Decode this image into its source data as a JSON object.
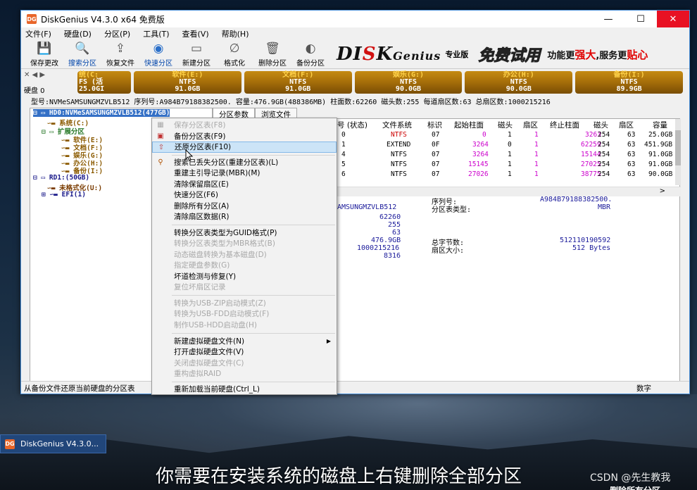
{
  "window": {
    "title": "DiskGenius V4.3.0 x64 免费版",
    "controls": {
      "minimize": "—",
      "maximize": "☐",
      "close": "✕"
    }
  },
  "menubar": [
    "文件(F)",
    "硬盘(D)",
    "分区(P)",
    "工具(T)",
    "查看(V)",
    "帮助(H)"
  ],
  "toolbar": [
    {
      "label": "保存更改",
      "icon": "save-icon"
    },
    {
      "label": "搜索分区",
      "icon": "search-icon"
    },
    {
      "label": "恢复文件",
      "icon": "recover-icon"
    },
    {
      "label": "快速分区",
      "icon": "quick-partition-icon"
    },
    {
      "label": "新建分区",
      "icon": "new-partition-icon"
    },
    {
      "label": "格式化",
      "icon": "format-icon"
    },
    {
      "label": "删除分区",
      "icon": "delete-icon"
    },
    {
      "label": "备份分区",
      "icon": "backup-icon"
    }
  ],
  "banner": {
    "logo_a": "DI",
    "logo_b": "K",
    "logo_c": "Genius",
    "edition": "专业版",
    "free": "免费试用",
    "slogan_a": "功能更",
    "slogan_b": "强大",
    "slogan_c": ",服务更",
    "slogan_d": "贴心"
  },
  "disk_nav": {
    "label": "硬盘 0"
  },
  "partitions": [
    {
      "name": "统(C:",
      "fs": "FS (活",
      "size": "25.0GI"
    },
    {
      "name": "软件(E:)",
      "fs": "NTFS",
      "size": "91.0GB"
    },
    {
      "name": "文档(F:)",
      "fs": "NTFS",
      "size": "91.0GB"
    },
    {
      "name": "娱乐(G:)",
      "fs": "NTFS",
      "size": "90.0GB"
    },
    {
      "name": "办公(H:)",
      "fs": "NTFS",
      "size": "90.0GB"
    },
    {
      "name": "备份(I:)",
      "fs": "NTFS",
      "size": "89.9GB"
    }
  ],
  "diskinfo": "型号:NVMeSAMSUNGMZVLB512  序列号:A984B79188382500.   容量:476.9GB(488386MB)  柱面数:62260  磁头数:255  每道扇区数:63  总扇区数:1000215216",
  "tree": {
    "hd0": "HD0:NVMeSAMSUNGMZVLB512(477GB)",
    "c": "系统(C:)",
    "ext": "扩展分区",
    "e": "软件(E:)",
    "f": "文档(F:)",
    "g": "娱乐(G:)",
    "h": "办公(H:)",
    "i": "备份(I:)",
    "rd1": "RD1:(50GB)",
    "unformatted": "未格式化(U:)",
    "efi": "EFI(1)"
  },
  "tabs": [
    "分区参数",
    "浏览文件"
  ],
  "table": {
    "headers": [
      "号 (状态)",
      "文件系统",
      "标识",
      "起始柱面",
      "磁头",
      "扇区",
      "终止柱面",
      "磁头",
      "扇区",
      "容量"
    ],
    "rows": [
      [
        "0",
        "NTFS",
        "07",
        "0",
        "1",
        "1",
        "3263",
        "254",
        "63",
        "25.0GB"
      ],
      [
        "1",
        "EXTEND",
        "0F",
        "3264",
        "0",
        "1",
        "62259",
        "254",
        "63",
        "451.9GB"
      ],
      [
        "4",
        "NTFS",
        "07",
        "3264",
        "1",
        "1",
        "15144",
        "254",
        "63",
        "91.0GB"
      ],
      [
        "5",
        "NTFS",
        "07",
        "15145",
        "1",
        "1",
        "27025",
        "254",
        "63",
        "91.0GB"
      ],
      [
        "6",
        "NTFS",
        "07",
        "27026",
        "1",
        "1",
        "38775",
        "254",
        "63",
        "90.0GB"
      ]
    ]
  },
  "details": {
    "model": "AMSUNGMZVLB512",
    "cyl": "62260",
    "heads": "255",
    "spt": "63",
    "cap": "476.9GB",
    "sectors": "1000215216",
    "extra": "8316",
    "serial_label": "序列号:",
    "serial_value": "A984B79188382500.",
    "ptype_label": "分区表类型:",
    "ptype_value": "MBR",
    "bytes_label": "总字节数:",
    "bytes_value": "512110190592",
    "secsize_label": "扇区大小:",
    "secsize_value": "512 Bytes"
  },
  "status": {
    "text": "从备份文件还原当前硬盘的分区表",
    "num": "数字"
  },
  "context_menu": [
    {
      "label": "保存分区表(F8)",
      "disabled": true,
      "icon": "save-icon"
    },
    {
      "label": "备份分区表(F9)",
      "disabled": false,
      "icon": "backup-table-icon"
    },
    {
      "label": "还原分区表(F10)",
      "disabled": false,
      "hover": true,
      "icon": "restore-table-icon"
    },
    {
      "sep": true
    },
    {
      "label": "搜索已丢失分区(重建分区表)(L)",
      "disabled": false,
      "icon": "search-icon"
    },
    {
      "label": "重建主引导记录(MBR)(M)",
      "disabled": false
    },
    {
      "label": "清除保留扇区(E)",
      "disabled": false
    },
    {
      "label": "快速分区(F6)",
      "disabled": false
    },
    {
      "label": "删除所有分区(A)",
      "disabled": false
    },
    {
      "label": "清除扇区数据(R)",
      "disabled": false
    },
    {
      "sep": true
    },
    {
      "label": "转换分区表类型为GUID格式(P)",
      "disabled": false
    },
    {
      "label": "转换分区表类型为MBR格式(B)",
      "disabled": true
    },
    {
      "label": "动态磁盘转换为基本磁盘(D)",
      "disabled": true
    },
    {
      "label": "指定硬盘参数(G)",
      "disabled": true
    },
    {
      "label": "坏道检测与修复(Y)",
      "disabled": false
    },
    {
      "label": "复位坏扇区记录",
      "disabled": true
    },
    {
      "sep": true
    },
    {
      "label": "转换为USB-ZIP启动模式(Z)",
      "disabled": true
    },
    {
      "label": "转换为USB-FDD启动模式(F)",
      "disabled": true
    },
    {
      "label": "制作USB-HDD启动盘(H)",
      "disabled": true
    },
    {
      "sep": true
    },
    {
      "label": "新建虚拟硬盘文件(N)",
      "disabled": false,
      "submenu": true
    },
    {
      "label": "打开虚拟硬盘文件(V)",
      "disabled": false
    },
    {
      "label": "关闭虚拟硬盘文件(C)",
      "disabled": true
    },
    {
      "label": "重构虚拟RAID",
      "disabled": true
    },
    {
      "sep": true
    },
    {
      "label": "重新加载当前硬盘(Ctrl_L)",
      "disabled": false
    }
  ],
  "taskbar": {
    "label": "DiskGenius V4.3.0..."
  },
  "subtitle": "你需要在安装系统的磁盘上右键删除全部分区",
  "watermark": "CSDN @先生教我",
  "subtitle2": "删除所有分区"
}
